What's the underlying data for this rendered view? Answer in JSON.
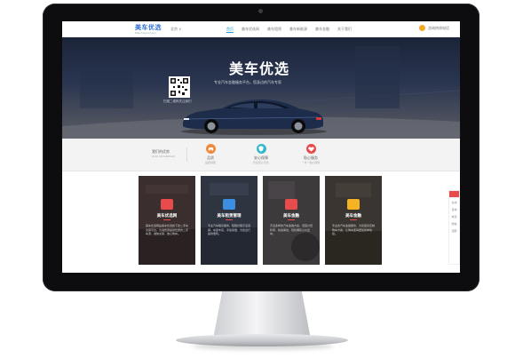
{
  "brand": {
    "logo_main": "美车优选",
    "logo_sub": "Meicheyouxuan"
  },
  "nav": {
    "city": "北京 ∨",
    "items": [
      "首页",
      "美车优选网",
      "美车租赁",
      "美车新能源",
      "美车金融",
      "关于我们"
    ],
    "active_index": 0,
    "phone": "咨询热线电话"
  },
  "hero": {
    "title": "美车优选",
    "subtitle": "专业汽车金融服务平台，您身边的汽车专家",
    "qr_caption": "扫描二维码关注我们"
  },
  "features": {
    "label": "我们的优势",
    "label_sub": "OUR ADVANTAGE",
    "items": [
      {
        "title": "品质",
        "sub": "品质保障",
        "color": "#f08a3c",
        "icon": "car-icon"
      },
      {
        "title": "安心保障",
        "sub": "售后安心无忧",
        "color": "#34b9c8",
        "icon": "shield-icon"
      },
      {
        "title": "贴心服务",
        "sub": "一对一贴心服务",
        "color": "#e84b4b",
        "icon": "heart-icon"
      }
    ]
  },
  "cards": [
    {
      "title": "美车优选网",
      "body": "美车优选网是美车优选旗下的二手车交易平台，为消费者提供优质的二手车源，诚信交易，放心购车。",
      "color": "#e84b4b",
      "bg": "#3a2e2e",
      "icon": "car-icon"
    },
    {
      "title": "美车租赁管理",
      "body": "专业汽车租赁服务，短租长租灵活选择，车型丰富，手续简便，为您出行提供便利。",
      "color": "#3b8ee0",
      "bg": "#2e3440",
      "icon": "key-icon"
    },
    {
      "title": "美车金融",
      "body": "灵活多样的汽车金融方案，低首付低利率，快速审批，轻松拥有心仪爱车。",
      "color": "#e84b4b",
      "bg": "#3d3a3c",
      "icon": "money-icon"
    },
    {
      "title": "美车金融",
      "body": "专业的汽车金融服务，为您量身定制购车方案，让购车变得更加简单快捷。",
      "color": "#f5b223",
      "bg": "#3a3530",
      "icon": "coin-icon"
    }
  ],
  "sidebar": {
    "items": [
      "在线",
      "咨询",
      "电话",
      "微信",
      "顶部"
    ]
  }
}
